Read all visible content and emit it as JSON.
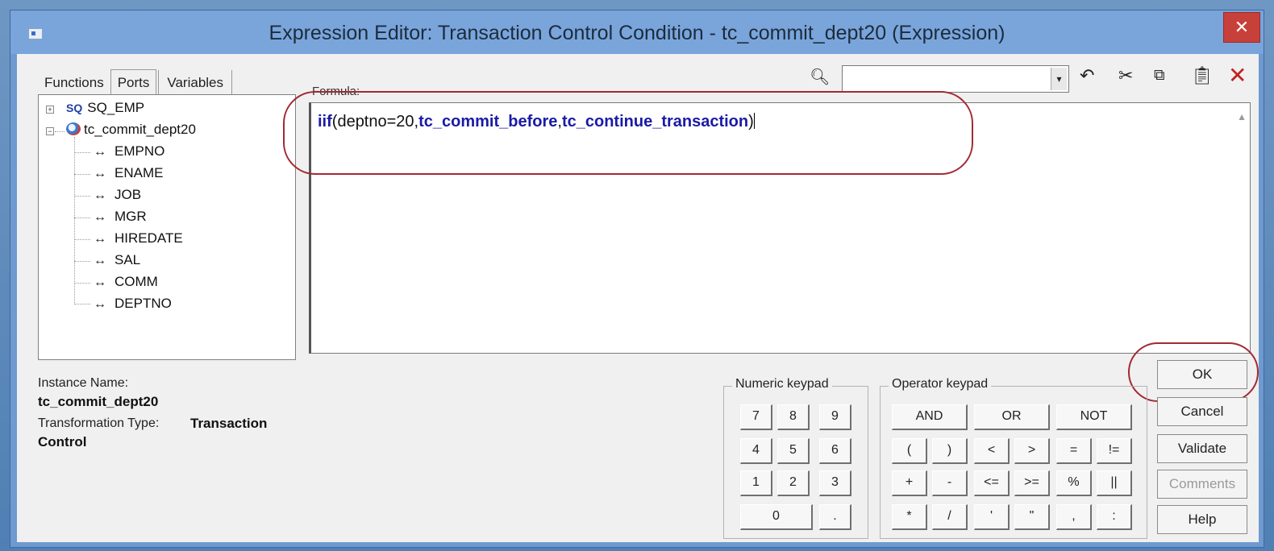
{
  "window": {
    "title": "Expression Editor: Transaction Control Condition - tc_commit_dept20 (Expression)",
    "close": "✕"
  },
  "tabs": [
    "Functions",
    "Ports",
    "Variables"
  ],
  "tree": {
    "source": "SQ_EMP",
    "source_icon": "SQ",
    "transform": "tc_commit_dept20",
    "ports": [
      "EMPNO",
      "ENAME",
      "JOB",
      "MGR",
      "HIREDATE",
      "SAL",
      "COMM",
      "DEPTNO"
    ],
    "port_icon": "↔"
  },
  "instance": {
    "name_label": "Instance Name:",
    "name_value": "tc_commit_dept20",
    "type_label": "Transformation Type:",
    "type_value_1": "Transaction",
    "type_value_2": "Control"
  },
  "formula": {
    "label": "Formula:",
    "part1": "iif",
    "part2": "(deptno=20,",
    "part3": "tc_commit_before",
    "part4": ",",
    "part5": "tc_continue_transaction",
    "part6": ")"
  },
  "toolbar": {
    "find_icon": "binoculars-icon",
    "find_value": "",
    "combo_arrow": "▾",
    "icons": [
      "undo-icon",
      "cut-icon",
      "copy-icon",
      "paste-icon",
      "delete-icon"
    ]
  },
  "numeric_keypad": {
    "title": "Numeric keypad",
    "keys": [
      "7",
      "8",
      "9",
      "4",
      "5",
      "6",
      "1",
      "2",
      "3",
      "0",
      "."
    ]
  },
  "operator_keypad": {
    "title": "Operator keypad",
    "row1": [
      "AND",
      "OR",
      "NOT"
    ],
    "row2": [
      "(",
      ")",
      "<",
      ">",
      "=",
      "!="
    ],
    "row3": [
      "+",
      "-",
      "<=",
      ">=",
      "%",
      "||"
    ],
    "row4": [
      "*",
      "/",
      "'",
      "\"",
      ",",
      ":"
    ]
  },
  "buttons": {
    "ok": "OK",
    "cancel": "Cancel",
    "validate": "Validate",
    "comments": "Comments",
    "help": "Help"
  },
  "colors": {
    "formula_keyword": "#1a1aa6",
    "highlight_ellipse": "#a32a32",
    "title_bar": "#79a5db"
  }
}
